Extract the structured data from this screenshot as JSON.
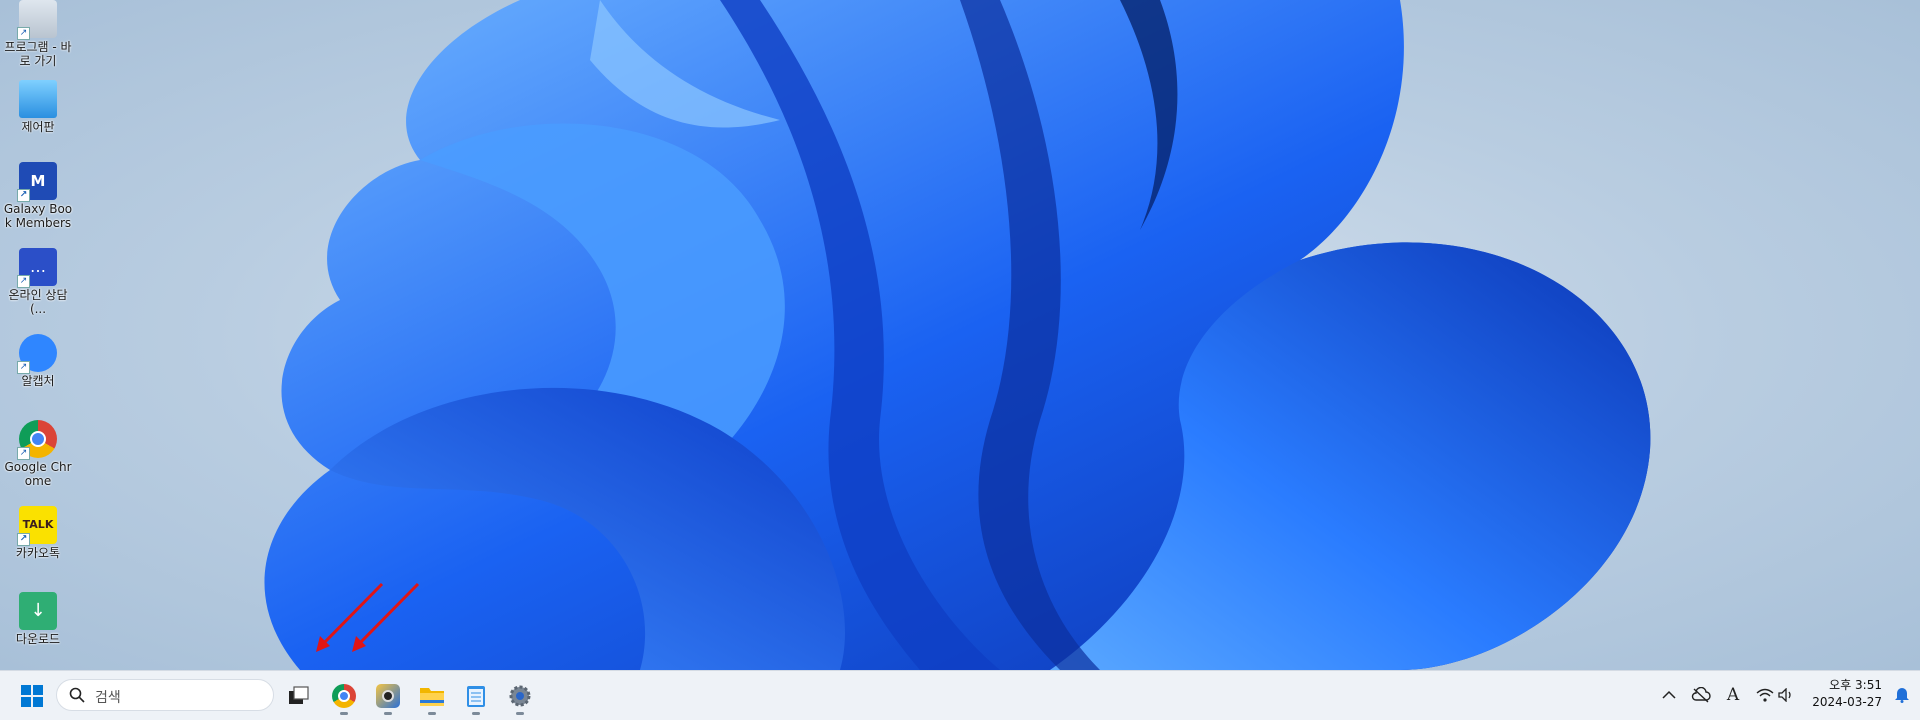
{
  "desktop_icons": [
    {
      "label": "프로그램 - 바로 가기",
      "icon": "program-shortcut-icon"
    },
    {
      "label": "제어판",
      "icon": "control-panel-icon"
    },
    {
      "label": "Galaxy Book Members",
      "icon": "galaxy-book-members-icon"
    },
    {
      "label": "온라인 상담(...",
      "icon": "online-chat-icon"
    },
    {
      "label": "알캡처",
      "icon": "alcapture-icon"
    },
    {
      "label": "Google Chrome",
      "icon": "chrome-icon"
    },
    {
      "label": "카카오톡",
      "icon": "kakaotalk-icon"
    },
    {
      "label": "다운로드",
      "icon": "download-folder-icon"
    }
  ],
  "taskbar": {
    "search_placeholder": "검색",
    "pinned": [
      "start-icon",
      "task-view-icon",
      "chrome-icon",
      "media-app-icon",
      "file-explorer-icon",
      "notepad-icon",
      "settings-icon"
    ]
  },
  "tray": {
    "ime_label": "A",
    "time": "오후 3:51",
    "date": "2024-03-27"
  },
  "colors": {
    "accent": "#0067c0",
    "wallpaper_blue": "#1a5cf0",
    "annotation_arrow": "#e01515"
  }
}
